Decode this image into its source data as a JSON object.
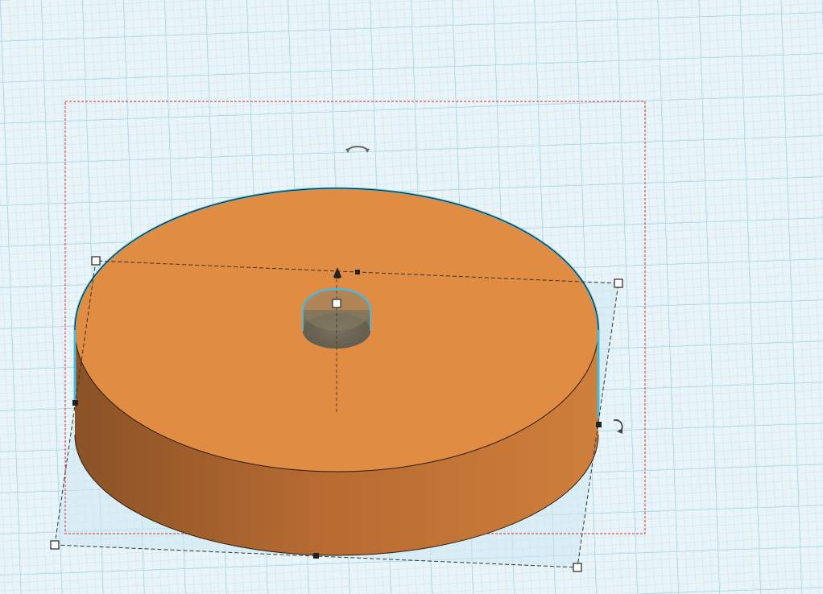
{
  "app": {
    "view": "3d-workplane",
    "selected_shape": "cylinder"
  },
  "colors": {
    "workplane_bg": "#e8f4f8",
    "grid_minor": "#b8dbe8",
    "grid_major": "#8cc3d8",
    "shape_top": "#e08c43",
    "shape_side_dark": "#8e5428",
    "shape_side_light": "#c9793a",
    "selection_outline": "#4ab8d8",
    "bounding_box": "#d42a3a",
    "handle_fill": "#ffffff",
    "handle_stroke": "#333333",
    "hole_fill": "#6e6a5a"
  },
  "icons": {
    "rotate_top": "rotate-arc-icon",
    "rotate_side": "rotate-side-icon",
    "lift_cone": "lift-cone-icon"
  }
}
